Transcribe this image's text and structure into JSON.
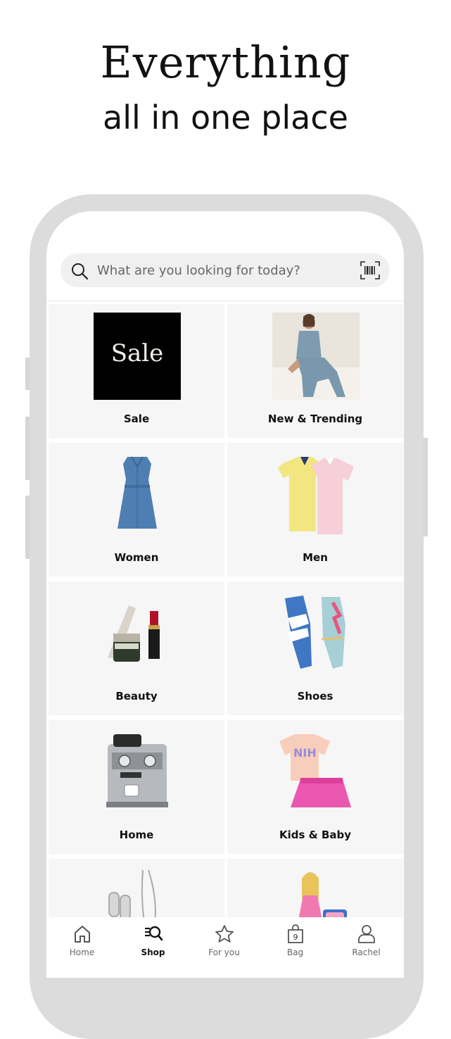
{
  "hero": {
    "title": "Everything",
    "subtitle": "all in one place"
  },
  "search": {
    "placeholder": "What are you looking for today?"
  },
  "categories": [
    {
      "label": "Sale",
      "thumb_text": "Sale"
    },
    {
      "label": "New & Trending"
    },
    {
      "label": "Women"
    },
    {
      "label": "Men"
    },
    {
      "label": "Beauty"
    },
    {
      "label": "Shoes"
    },
    {
      "label": "Home"
    },
    {
      "label": "Kids & Baby"
    }
  ],
  "tabbar": {
    "tabs": [
      {
        "label": "Home",
        "icon": "home-icon"
      },
      {
        "label": "Shop",
        "icon": "shop-search-icon",
        "active": true
      },
      {
        "label": "For you",
        "icon": "star-icon"
      },
      {
        "label": "Bag",
        "icon": "bag-icon",
        "badge": "9"
      },
      {
        "label": "Rachel",
        "icon": "person-icon"
      }
    ]
  },
  "colors": {
    "accent": "#111111",
    "tile_bg": "#f6f6f6",
    "frame": "#dcdcdc"
  }
}
